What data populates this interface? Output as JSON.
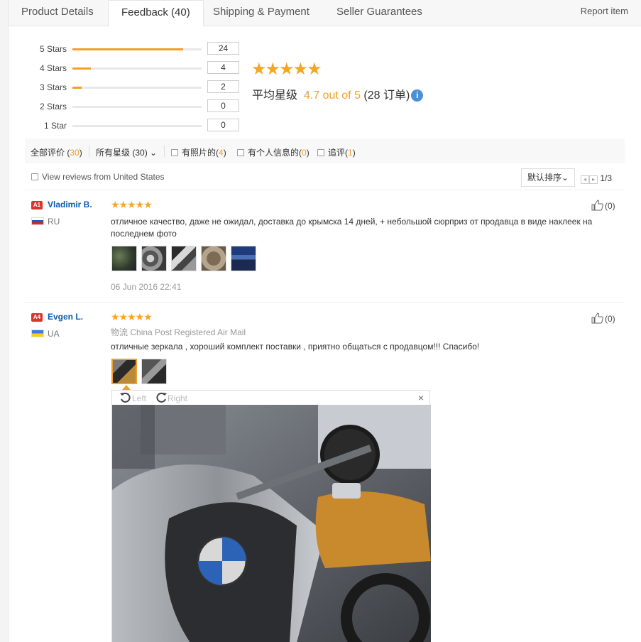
{
  "tabs": [
    {
      "label": "Product Details"
    },
    {
      "label": "Feedback (40)"
    },
    {
      "label": "Shipping & Payment"
    },
    {
      "label": "Seller Guarantees"
    }
  ],
  "report_label": "Report item",
  "histogram": [
    {
      "label": "5 Stars",
      "count": "24",
      "fraction": 0.857
    },
    {
      "label": "4 Stars",
      "count": "4",
      "fraction": 0.143
    },
    {
      "label": "3 Stars",
      "count": "2",
      "fraction": 0.071
    },
    {
      "label": "2 Stars",
      "count": "0",
      "fraction": 0
    },
    {
      "label": "1 Star",
      "count": "0",
      "fraction": 0
    }
  ],
  "summary": {
    "stars": "★★★★★",
    "avg_prefix": "平均星级",
    "avg_score": "4.7 out of 5",
    "orders": "(28 订单)",
    "info_glyph": "i"
  },
  "filters": {
    "all": {
      "label": "全部评价",
      "count": "30"
    },
    "stars": {
      "label": "所有星级",
      "count": "(30)",
      "chevron": "⌄"
    },
    "photos": {
      "label": "有照片的",
      "count": "4"
    },
    "personal": {
      "label": "有个人信息的",
      "count": "0"
    },
    "followup": {
      "label": "追评",
      "count": "1"
    }
  },
  "view_us_label": "View reviews from United States",
  "sort_label": "默认排序",
  "pager": {
    "text": "1/3",
    "prev": "◂",
    "next": "▸"
  },
  "reviews": [
    {
      "badge": "A1",
      "name": "Vladimir B.",
      "country": "RU",
      "stars": "★★★★★",
      "helpful": "(0)",
      "text": "отличное качество, даже не ожидал, доставка до крымска 14 дней, + небольшой сюрприз от продавца в виде наклеек на последнем фото",
      "date": "06 Jun 2016 22:41"
    },
    {
      "badge": "A4",
      "name": "Evgen L.",
      "country": "UA",
      "stars": "★★★★★",
      "helpful": "(0)",
      "logistics_prefix": "物流",
      "logistics": "China Post Registered Air Mail",
      "text": "отличные зеркала , хороший комплект поставки , приятно общаться с продавцом!!! Спасибо!"
    }
  ],
  "viewer": {
    "left_label": "Left",
    "right_label": "Right",
    "close": "×"
  },
  "colors": {
    "accent": "#f0a028",
    "link": "#0b5cad",
    "badge": "#d9362b"
  }
}
